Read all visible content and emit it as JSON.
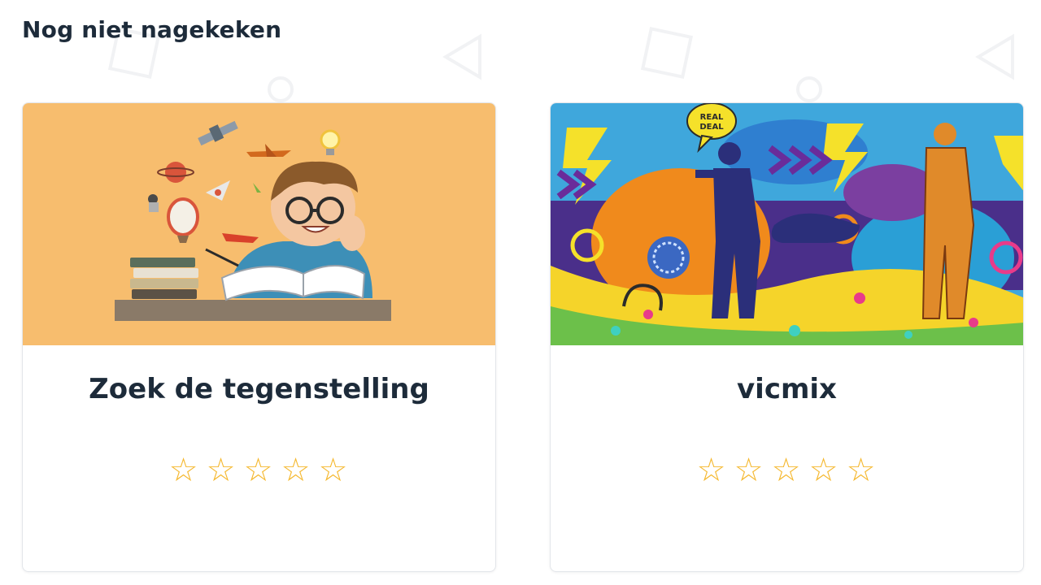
{
  "section": {
    "title": "Nog niet nagekeken"
  },
  "cards": [
    {
      "title": "Zoek de tegenstelling",
      "rating": 0,
      "max_rating": 5,
      "stars": [
        "☆",
        "☆",
        "☆",
        "☆",
        "☆"
      ],
      "image": "student-reading-illustration"
    },
    {
      "title": "vicmix",
      "rating": 0,
      "max_rating": 5,
      "stars": [
        "☆",
        "☆",
        "☆",
        "☆",
        "☆"
      ],
      "image": "graffiti-collage",
      "image_text": {
        "speech_bubble_line1": "REAL",
        "speech_bubble_line2": "DEAL"
      }
    }
  ],
  "colors": {
    "star": "#f5b82e",
    "title": "#1d2b3a",
    "card_border": "#e3e6ea",
    "thumb1_bg": "#f7bd6e",
    "thumb2_bg": "#3fa7dc"
  }
}
